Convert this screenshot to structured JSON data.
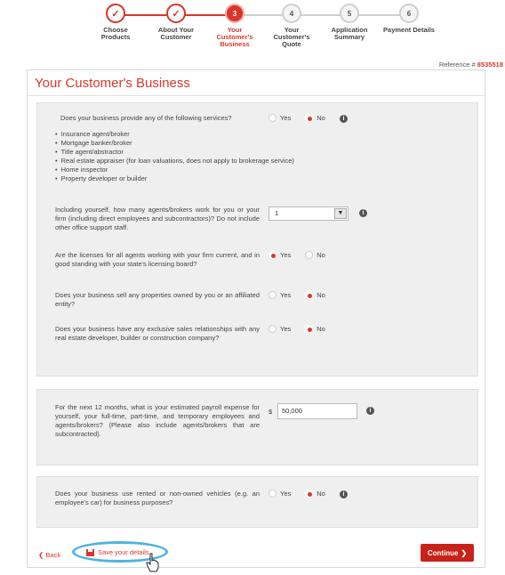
{
  "steps": [
    {
      "label": "Choose\nProducts",
      "state": "done",
      "symbol": "✓"
    },
    {
      "label": "About Your\nCustomer",
      "state": "done",
      "symbol": "✓"
    },
    {
      "label": "Your\nCustomer's\nBusiness",
      "state": "current",
      "symbol": "3"
    },
    {
      "label": "Your\nCustomer's\nQuote",
      "state": "todo",
      "symbol": "4"
    },
    {
      "label": "Application\nSummary",
      "state": "todo",
      "symbol": "5"
    },
    {
      "label": "Payment Details",
      "state": "todo",
      "symbol": "6"
    }
  ],
  "reference": {
    "label": "Reference #",
    "number": "8535518"
  },
  "page_title": "Your Customer's Business",
  "q1": {
    "text": "Does your business provide any of the following services?",
    "yes": "Yes",
    "no": "No",
    "selected": "No",
    "bullets": [
      "Insurance agent/broker",
      "Mortgage banker/broker",
      "Title agent/abstractor",
      "Real estate appraiser (for loan valuations, does not apply to brokerage service)",
      "Home inspector",
      "Property developer or builder"
    ]
  },
  "q2": {
    "text": "Including yourself, how many agents/brokers work for you or your firm (including direct employees and subcontractors)? Do not include other office support staff.",
    "value": "1"
  },
  "q3": {
    "text": "Are the licenses for all agents working with your firm current, and in good standing with your state's licensing board?",
    "yes": "Yes",
    "no": "No",
    "selected": "Yes"
  },
  "q4": {
    "text": "Does your business sell any properties owned by you or an affiliated entity?",
    "yes": "Yes",
    "no": "No",
    "selected": "No"
  },
  "q5": {
    "text": "Does your business have any exclusive sales relationships with any real estate developer, builder or construction company?",
    "yes": "Yes",
    "no": "No",
    "selected": "No"
  },
  "q6": {
    "text": "For the next 12 months, what is your estimated payroll expense for yourself, your full-time, part-time, and temporary employees and agents/brokers? (Please also include agents/brokers that are subcontracted).",
    "currency": "$",
    "value": "50,000"
  },
  "q7": {
    "text": "Does your business use rented or non-owned vehicles (e.g. an employee's car) for business purposes?",
    "yes": "Yes",
    "no": "No",
    "selected": "No"
  },
  "footer": {
    "back": "Back",
    "save": "Save your details",
    "continue": "Continue"
  },
  "colors": {
    "accent": "#d9362b",
    "highlight": "#4fb3dc"
  }
}
